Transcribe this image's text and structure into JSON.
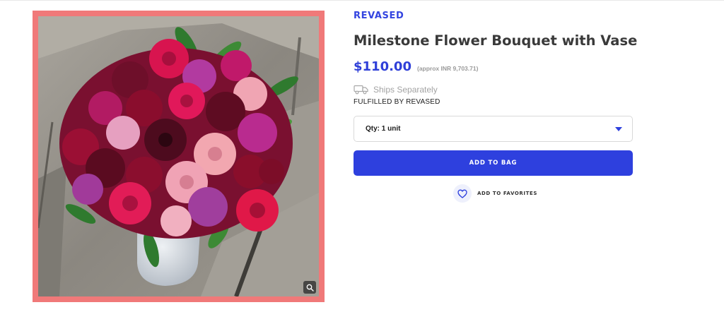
{
  "product": {
    "brand": "REVASED",
    "title": "Milestone Flower Bouquet with Vase",
    "price": "$110.00",
    "price_approx": "(approx INR 9,703.71)",
    "image_alt": "Milestone Flower Bouquet with Vase"
  },
  "shipping": {
    "icon": "truck-icon",
    "ships_text": "Ships Separately",
    "fulfilled_text": "FULFILLED BY REVASED"
  },
  "quantity": {
    "selected_label": "Qty: 1 unit"
  },
  "actions": {
    "add_to_bag_label": "ADD TO BAG",
    "favorites_label": "ADD TO FAVORITES"
  },
  "colors": {
    "accent": "#2e40de",
    "image_border": "#f07979"
  }
}
